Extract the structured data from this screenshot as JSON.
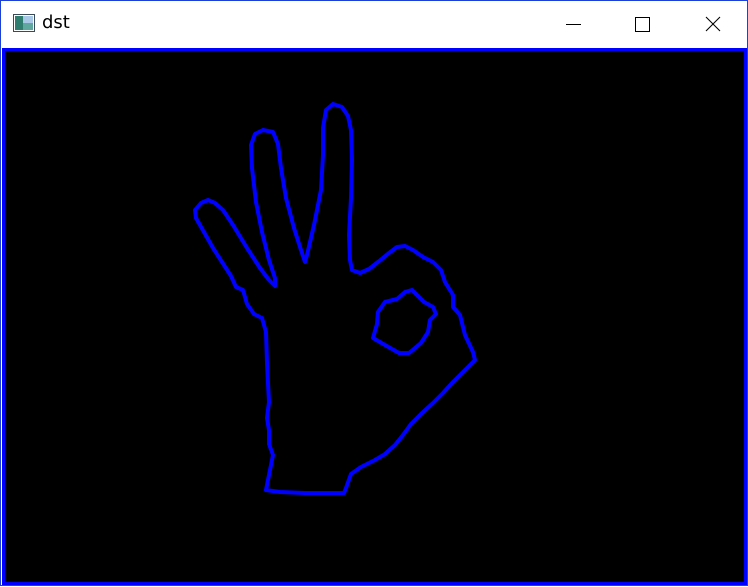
{
  "window": {
    "title": "dst",
    "app_icon": "opencv-window-icon",
    "controls": {
      "minimize_icon": "minimize-icon",
      "maximize_icon": "maximize-icon",
      "close_icon": "close-icon"
    }
  },
  "canvas": {
    "background_color": "#000000",
    "contour_color": "#0000ff",
    "border_color": "#0000ff",
    "depicts": "hand-ok-gesture-contour"
  }
}
